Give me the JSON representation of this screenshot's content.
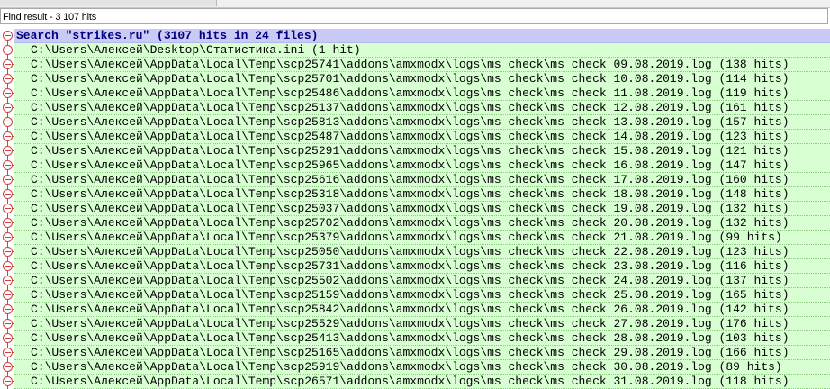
{
  "window": {
    "title": "Find result - 3 107 hits"
  },
  "search": {
    "header": "Search \"strikes.ru\" (3107 hits in 24 files)"
  },
  "files": [
    "C:\\Users\\Алексей\\Desktop\\Статистика.ini (1 hit)",
    "C:\\Users\\Алексей\\AppData\\Local\\Temp\\scp25741\\addons\\amxmodx\\logs\\ms check\\ms check 09.08.2019.log (138 hits)",
    "C:\\Users\\Алексей\\AppData\\Local\\Temp\\scp25701\\addons\\amxmodx\\logs\\ms check\\ms check 10.08.2019.log (114 hits)",
    "C:\\Users\\Алексей\\AppData\\Local\\Temp\\scp25486\\addons\\amxmodx\\logs\\ms check\\ms check 11.08.2019.log (119 hits)",
    "C:\\Users\\Алексей\\AppData\\Local\\Temp\\scp25137\\addons\\amxmodx\\logs\\ms check\\ms check 12.08.2019.log (161 hits)",
    "C:\\Users\\Алексей\\AppData\\Local\\Temp\\scp25813\\addons\\amxmodx\\logs\\ms check\\ms check 13.08.2019.log (157 hits)",
    "C:\\Users\\Алексей\\AppData\\Local\\Temp\\scp25487\\addons\\amxmodx\\logs\\ms check\\ms check 14.08.2019.log (123 hits)",
    "C:\\Users\\Алексей\\AppData\\Local\\Temp\\scp25291\\addons\\amxmodx\\logs\\ms check\\ms check 15.08.2019.log (121 hits)",
    "C:\\Users\\Алексей\\AppData\\Local\\Temp\\scp25965\\addons\\amxmodx\\logs\\ms check\\ms check 16.08.2019.log (147 hits)",
    "C:\\Users\\Алексей\\AppData\\Local\\Temp\\scp25616\\addons\\amxmodx\\logs\\ms check\\ms check 17.08.2019.log (160 hits)",
    "C:\\Users\\Алексей\\AppData\\Local\\Temp\\scp25318\\addons\\amxmodx\\logs\\ms check\\ms check 18.08.2019.log (148 hits)",
    "C:\\Users\\Алексей\\AppData\\Local\\Temp\\scp25037\\addons\\amxmodx\\logs\\ms check\\ms check 19.08.2019.log (132 hits)",
    "C:\\Users\\Алексей\\AppData\\Local\\Temp\\scp25702\\addons\\amxmodx\\logs\\ms check\\ms check 20.08.2019.log (132 hits)",
    "C:\\Users\\Алексей\\AppData\\Local\\Temp\\scp25379\\addons\\amxmodx\\logs\\ms check\\ms check 21.08.2019.log (99 hits)",
    "C:\\Users\\Алексей\\AppData\\Local\\Temp\\scp25050\\addons\\amxmodx\\logs\\ms check\\ms check 22.08.2019.log (123 hits)",
    "C:\\Users\\Алексей\\AppData\\Local\\Temp\\scp25731\\addons\\amxmodx\\logs\\ms check\\ms check 23.08.2019.log (116 hits)",
    "C:\\Users\\Алексей\\AppData\\Local\\Temp\\scp25502\\addons\\amxmodx\\logs\\ms check\\ms check 24.08.2019.log (137 hits)",
    "C:\\Users\\Алексей\\AppData\\Local\\Temp\\scp25159\\addons\\amxmodx\\logs\\ms check\\ms check 25.08.2019.log (165 hits)",
    "C:\\Users\\Алексей\\AppData\\Local\\Temp\\scp25842\\addons\\amxmodx\\logs\\ms check\\ms check 26.08.2019.log (142 hits)",
    "C:\\Users\\Алексей\\AppData\\Local\\Temp\\scp25529\\addons\\amxmodx\\logs\\ms check\\ms check 27.08.2019.log (176 hits)",
    "C:\\Users\\Алексей\\AppData\\Local\\Temp\\scp25413\\addons\\amxmodx\\logs\\ms check\\ms check 28.08.2019.log (103 hits)",
    "C:\\Users\\Алексей\\AppData\\Local\\Temp\\scp25165\\addons\\amxmodx\\logs\\ms check\\ms check 29.08.2019.log (166 hits)",
    "C:\\Users\\Алексей\\AppData\\Local\\Temp\\scp25919\\addons\\amxmodx\\logs\\ms check\\ms check 30.08.2019.log (89 hits)",
    "C:\\Users\\Алексей\\AppData\\Local\\Temp\\scp26571\\addons\\amxmodx\\logs\\ms check\\ms check 31.08.2019.log (118 hits)"
  ],
  "icons": {
    "fold": "fold-minus-icon"
  },
  "colors": {
    "header_bg": "#c9caf5",
    "header_text": "#000080",
    "file_bg": "#d8ffd2",
    "fold_line": "#d04040"
  }
}
